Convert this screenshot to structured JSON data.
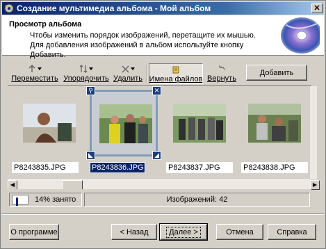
{
  "window": {
    "title": "Создание мультимедиа альбома - Мой альбом",
    "close_glyph": "✕"
  },
  "header": {
    "heading": "Просмотр альбома",
    "description": "Чтобы изменить порядок изображений, перетащите их мышью. Для добавления изображений в альбом используйте кнопку Добавить."
  },
  "toolbar": {
    "buttons": [
      {
        "label": "Переместить",
        "icon": "move-icon"
      },
      {
        "label": "Упорядочить",
        "icon": "arrange-icon"
      },
      {
        "label": "Удалить",
        "icon": "delete-icon"
      },
      {
        "label": "Имена файлов",
        "icon": "filenames-icon",
        "pressed": true
      },
      {
        "label": "Вернуть",
        "icon": "undo-icon"
      }
    ],
    "add_label": "Добавить"
  },
  "thumbnails": [
    {
      "file": "P8243835.JPG",
      "selected": false
    },
    {
      "file": "P8243836.JPG",
      "selected": true
    },
    {
      "file": "P8243837.JPG",
      "selected": false
    },
    {
      "file": "P8243838.JPG",
      "selected": false
    }
  ],
  "status": {
    "usage_text": "14% занято",
    "usage_fraction": 0.14,
    "image_count_text": "Изображений: 42"
  },
  "buttons": {
    "about": "О программе",
    "back": "< Назад",
    "next": "Далее >",
    "cancel": "Отмена",
    "help": "Справка"
  },
  "colors": {
    "titlebar": "#0a246a",
    "selection": "#0a246a",
    "face": "#d4d0c8"
  }
}
